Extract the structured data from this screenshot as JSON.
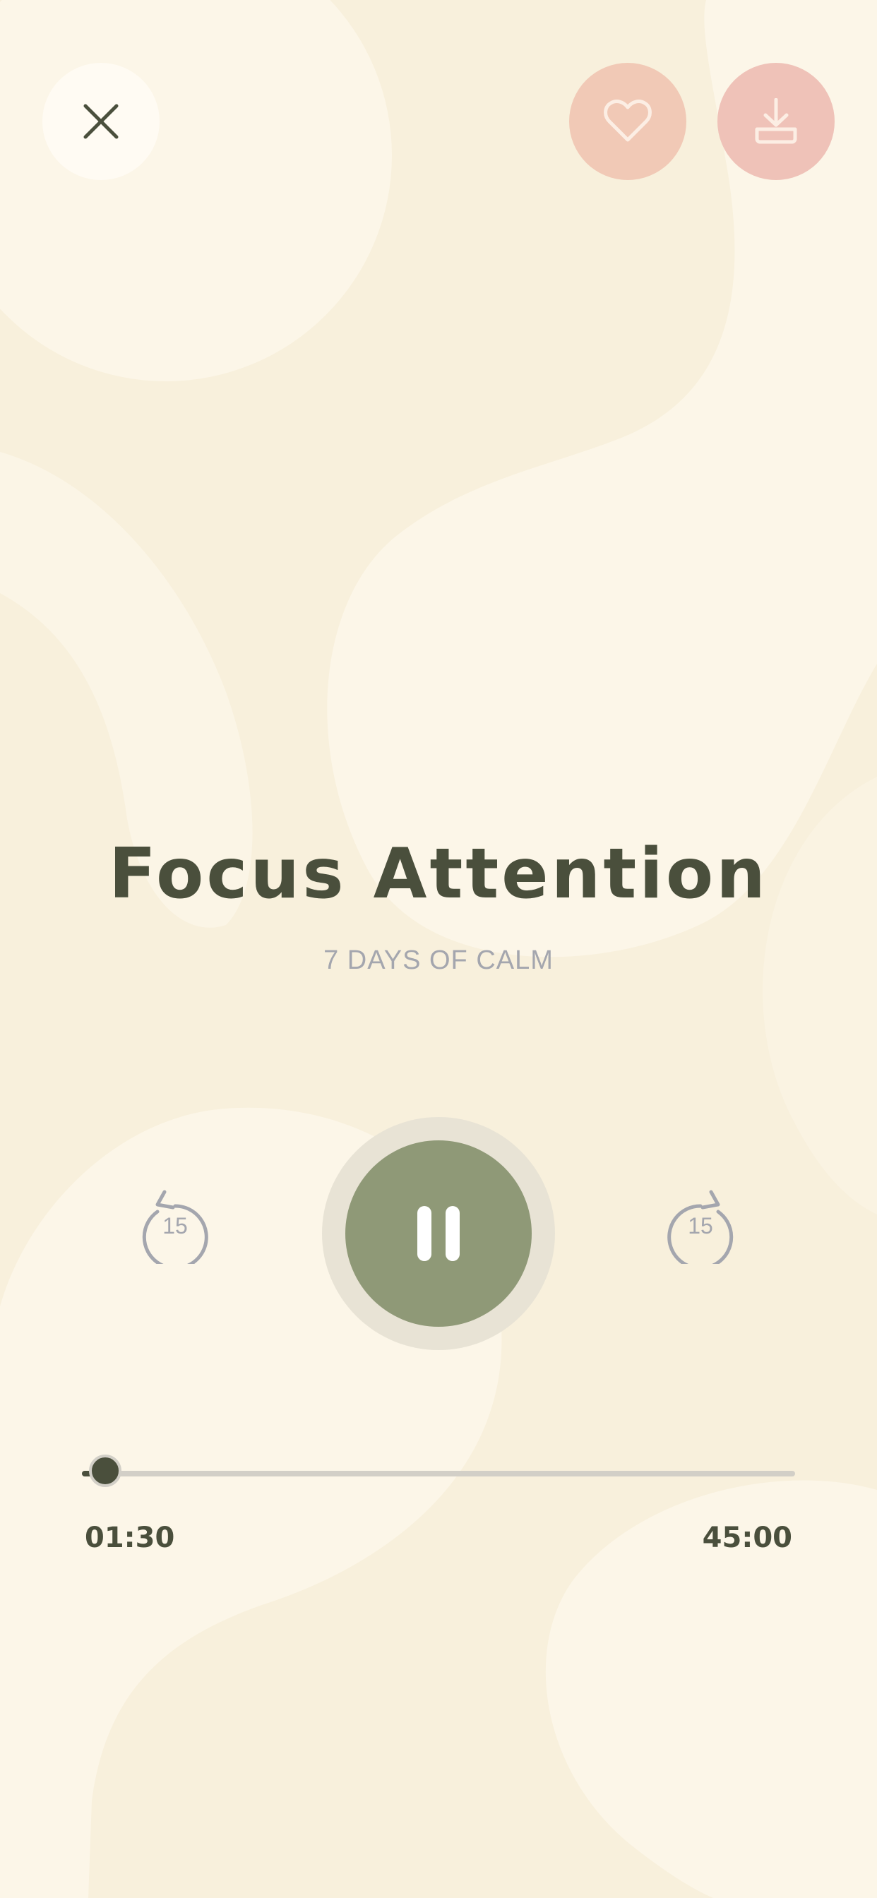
{
  "player": {
    "title": "Focus Attention",
    "subtitle": "7 DAYS OF CALM",
    "elapsed": "01:30",
    "total": "45:00",
    "progress": 0.033
  },
  "controls": {
    "skip_back_seconds": "15",
    "skip_forward_seconds": "15"
  },
  "icons": {
    "close": "close-icon",
    "favorite": "heart-icon",
    "download": "download-icon",
    "skip_back": "rewind-15-icon",
    "skip_forward": "forward-15-icon",
    "pause": "pause-icon"
  },
  "colors": {
    "background": "#F8F0DC",
    "background_shapes": "#FCF6E8",
    "text_primary": "#4A4F3C",
    "text_secondary": "#A4A6AE",
    "play_button": "#8F9977",
    "favorite_button": "#F1C9B6",
    "download_button": "#EFC2B8"
  }
}
